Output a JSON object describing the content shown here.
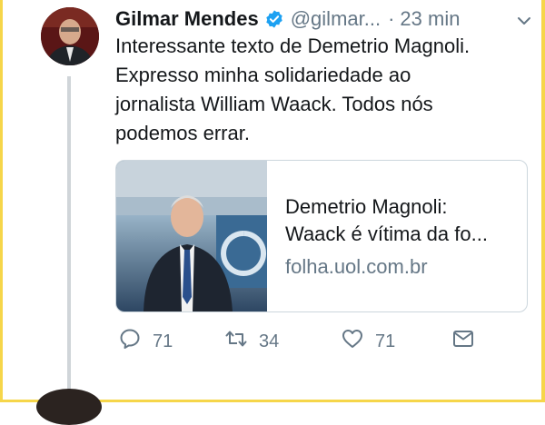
{
  "author": {
    "name": "Gilmar Mendes",
    "handle": "@gilmar...",
    "separator": "·",
    "time": "23 min"
  },
  "tweet": {
    "text": "Interessante texto de Demetrio Magnoli.\nExpresso minha solidariedade ao\njornalista William Waack. Todos nós\npodemos errar."
  },
  "card": {
    "title": "Demetrio Magnoli:\nWaack é vítima da fo...",
    "domain": "folha.uol.com.br"
  },
  "actions": {
    "replies": "71",
    "retweets": "34",
    "likes": "71"
  },
  "colors": {
    "verified": "#1da1f2",
    "muted": "#657786",
    "frame": "#f6d64a"
  },
  "icons": [
    "verified-badge-icon",
    "chevron-down-icon",
    "reply-icon",
    "retweet-icon",
    "like-icon",
    "direct-message-icon"
  ]
}
